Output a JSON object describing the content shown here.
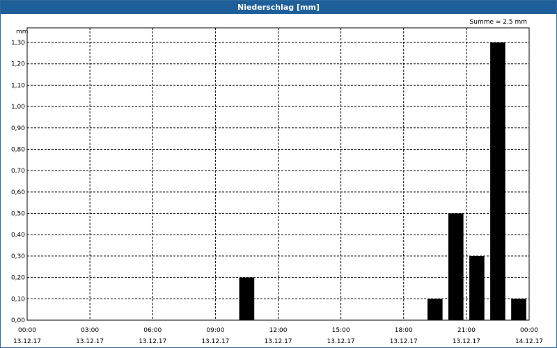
{
  "window": {
    "title": "Niederschlag [mm]"
  },
  "chart_data": {
    "type": "bar",
    "title": "Niederschlag [mm]",
    "ylabel": "mm",
    "annotation": "Summe = 2,5 mm",
    "ylim": [
      0,
      1.3
    ],
    "y_ticks": [
      "0,00",
      "0,10",
      "0,20",
      "0,30",
      "0,40",
      "0,50",
      "0,60",
      "0,70",
      "0,80",
      "0,90",
      "1,00",
      "1,10",
      "1,20",
      "1,30"
    ],
    "x_range_hours": [
      0,
      24
    ],
    "x_ticks": [
      {
        "time": "00:00",
        "date": "13.12.17"
      },
      {
        "time": "03:00",
        "date": "13.12.17"
      },
      {
        "time": "06:00",
        "date": "13.12.17"
      },
      {
        "time": "09:00",
        "date": "13.12.17"
      },
      {
        "time": "12:00",
        "date": "13.12.17"
      },
      {
        "time": "15:00",
        "date": "13.12.17"
      },
      {
        "time": "18:00",
        "date": "13.12.17"
      },
      {
        "time": "21:00",
        "date": "13.12.17"
      },
      {
        "time": "00:00",
        "date": "14.12.17"
      }
    ],
    "bars": [
      {
        "time": "10:00",
        "value": 0.2
      },
      {
        "time": "19:00",
        "value": 0.1
      },
      {
        "time": "20:00",
        "value": 0.5
      },
      {
        "time": "21:00",
        "value": 0.3
      },
      {
        "time": "22:00",
        "value": 1.3
      },
      {
        "time": "23:00",
        "value": 0.1
      }
    ],
    "bar_color": "#000000",
    "grid": true
  }
}
